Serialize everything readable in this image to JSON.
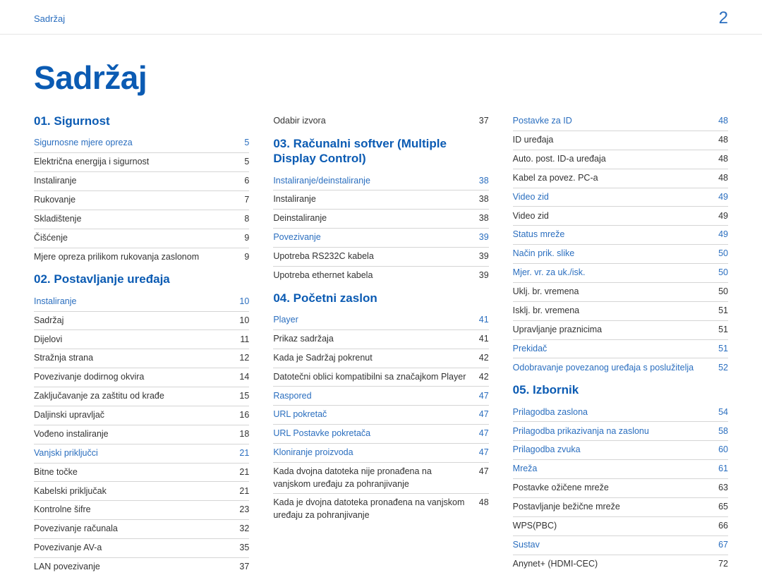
{
  "header": {
    "breadcrumb": "Sadržaj",
    "pageNumber": "2"
  },
  "title": "Sadržaj",
  "columns": [
    [
      {
        "type": "heading",
        "text": "01. Sigurnost",
        "first": true
      },
      {
        "type": "entry",
        "level": 1,
        "label": "Sigurnosne mjere opreza",
        "page": "5"
      },
      {
        "type": "sep"
      },
      {
        "type": "entry",
        "level": 2,
        "label": "Električna energija i sigurnost",
        "page": "5"
      },
      {
        "type": "sep"
      },
      {
        "type": "entry",
        "level": 2,
        "label": "Instaliranje",
        "page": "6"
      },
      {
        "type": "sep"
      },
      {
        "type": "entry",
        "level": 2,
        "label": "Rukovanje",
        "page": "7"
      },
      {
        "type": "sep"
      },
      {
        "type": "entry",
        "level": 2,
        "label": "Skladištenje",
        "page": "8"
      },
      {
        "type": "sep"
      },
      {
        "type": "entry",
        "level": 2,
        "label": "Čišćenje",
        "page": "9"
      },
      {
        "type": "sep"
      },
      {
        "type": "entry",
        "level": 2,
        "label": "Mjere opreza prilikom rukovanja zaslonom",
        "page": "9"
      },
      {
        "type": "heading",
        "text": "02. Postavljanje uređaja"
      },
      {
        "type": "entry",
        "level": 1,
        "label": "Instaliranje",
        "page": "10"
      },
      {
        "type": "sep"
      },
      {
        "type": "entry",
        "level": 2,
        "label": "Sadržaj",
        "page": "10"
      },
      {
        "type": "sep"
      },
      {
        "type": "entry",
        "level": 2,
        "label": "Dijelovi",
        "page": "11"
      },
      {
        "type": "sep"
      },
      {
        "type": "entry",
        "level": 2,
        "label": "Stražnja strana",
        "page": "12"
      },
      {
        "type": "sep"
      },
      {
        "type": "entry",
        "level": 2,
        "label": "Povezivanje dodirnog okvira",
        "page": "14"
      },
      {
        "type": "sep"
      },
      {
        "type": "entry",
        "level": 2,
        "label": "Zaključavanje za zaštitu od krađe",
        "page": "15"
      },
      {
        "type": "sep"
      },
      {
        "type": "entry",
        "level": 2,
        "label": "Daljinski upravljač",
        "page": "16"
      },
      {
        "type": "sep"
      },
      {
        "type": "entry",
        "level": 2,
        "label": "Vođeno instaliranje",
        "page": "18"
      },
      {
        "type": "sep"
      },
      {
        "type": "entry",
        "level": 1,
        "label": "Vanjski priključci",
        "page": "21"
      },
      {
        "type": "sep"
      },
      {
        "type": "entry",
        "level": 2,
        "label": "Bitne točke",
        "page": "21"
      },
      {
        "type": "sep"
      },
      {
        "type": "entry",
        "level": 2,
        "label": "Kabelski priključak",
        "page": "21"
      },
      {
        "type": "sep"
      },
      {
        "type": "entry",
        "level": 2,
        "label": "Kontrolne šifre",
        "page": "23"
      },
      {
        "type": "sep"
      },
      {
        "type": "entry",
        "level": 2,
        "label": "Povezivanje računala",
        "page": "32"
      },
      {
        "type": "sep"
      },
      {
        "type": "entry",
        "level": 2,
        "label": "Povezivanje AV-a",
        "page": "35"
      },
      {
        "type": "sep"
      },
      {
        "type": "entry",
        "level": 2,
        "label": "LAN povezivanje",
        "page": "37"
      }
    ],
    [
      {
        "type": "entry",
        "level": 2,
        "label": "Odabir izvora",
        "page": "37",
        "first": true
      },
      {
        "type": "heading",
        "text": "03. Računalni softver (Multiple Display Control)"
      },
      {
        "type": "entry",
        "level": 1,
        "label": "Instaliranje/deinstaliranje",
        "page": "38"
      },
      {
        "type": "sep"
      },
      {
        "type": "entry",
        "level": 2,
        "label": "Instaliranje",
        "page": "38"
      },
      {
        "type": "sep"
      },
      {
        "type": "entry",
        "level": 2,
        "label": "Deinstaliranje",
        "page": "38"
      },
      {
        "type": "sep"
      },
      {
        "type": "entry",
        "level": 1,
        "label": "Povezivanje",
        "page": "39"
      },
      {
        "type": "sep"
      },
      {
        "type": "entry",
        "level": 2,
        "label": "Upotreba RS232C kabela",
        "page": "39"
      },
      {
        "type": "sep"
      },
      {
        "type": "entry",
        "level": 2,
        "label": "Upotreba ethernet kabela",
        "page": "39"
      },
      {
        "type": "heading",
        "text": "04. Početni zaslon"
      },
      {
        "type": "entry",
        "level": 1,
        "label": "Player",
        "page": "41"
      },
      {
        "type": "sep"
      },
      {
        "type": "entry",
        "level": 2,
        "label": "Prikaz sadržaja",
        "page": "41"
      },
      {
        "type": "sep"
      },
      {
        "type": "entry",
        "level": 2,
        "label": "Kada je Sadržaj pokrenut",
        "page": "42"
      },
      {
        "type": "sep"
      },
      {
        "type": "entry",
        "level": 2,
        "label": "Datotečni oblici kompatibilni sa značajkom Player",
        "page": "42"
      },
      {
        "type": "sep"
      },
      {
        "type": "entry",
        "level": 1,
        "label": "Raspored",
        "page": "47"
      },
      {
        "type": "sep"
      },
      {
        "type": "entry",
        "level": 1,
        "label": "URL pokretač",
        "page": "47"
      },
      {
        "type": "sep"
      },
      {
        "type": "entry",
        "level": 1,
        "label": "URL Postavke pokretača",
        "page": "47"
      },
      {
        "type": "sep"
      },
      {
        "type": "entry",
        "level": 1,
        "label": "Kloniranje proizvoda",
        "page": "47"
      },
      {
        "type": "sep"
      },
      {
        "type": "entry",
        "level": 2,
        "label": "Kada dvojna datoteka nije pronađena na vanjskom uređaju za pohranjivanje",
        "page": "47"
      },
      {
        "type": "sep"
      },
      {
        "type": "entry",
        "level": 2,
        "label": "Kada je dvojna datoteka pronađena na vanjskom uređaju za pohranjivanje",
        "page": "48"
      }
    ],
    [
      {
        "type": "entry",
        "level": 1,
        "label": "Postavke za ID",
        "page": "48",
        "first": true
      },
      {
        "type": "sep"
      },
      {
        "type": "entry",
        "level": 2,
        "label": "ID uređaja",
        "page": "48"
      },
      {
        "type": "sep"
      },
      {
        "type": "entry",
        "level": 2,
        "label": "Auto. post. ID-a uređaja",
        "page": "48"
      },
      {
        "type": "sep"
      },
      {
        "type": "entry",
        "level": 2,
        "label": "Kabel za povez. PC-a",
        "page": "48"
      },
      {
        "type": "sep"
      },
      {
        "type": "entry",
        "level": 1,
        "label": "Video zid",
        "page": "49"
      },
      {
        "type": "sep"
      },
      {
        "type": "entry",
        "level": 2,
        "label": "Video zid",
        "page": "49"
      },
      {
        "type": "sep"
      },
      {
        "type": "entry",
        "level": 1,
        "label": "Status mreže",
        "page": "49"
      },
      {
        "type": "sep"
      },
      {
        "type": "entry",
        "level": 1,
        "label": "Način prik. slike",
        "page": "50"
      },
      {
        "type": "sep"
      },
      {
        "type": "entry",
        "level": 1,
        "label": "Mjer. vr. za uk./isk.",
        "page": "50"
      },
      {
        "type": "sep"
      },
      {
        "type": "entry",
        "level": 2,
        "label": "Uklj. br. vremena",
        "page": "50"
      },
      {
        "type": "sep"
      },
      {
        "type": "entry",
        "level": 2,
        "label": "Isklj. br. vremena",
        "page": "51"
      },
      {
        "type": "sep"
      },
      {
        "type": "entry",
        "level": 2,
        "label": "Upravljanje praznicima",
        "page": "51"
      },
      {
        "type": "sep"
      },
      {
        "type": "entry",
        "level": 1,
        "label": "Prekidač",
        "page": "51"
      },
      {
        "type": "sep"
      },
      {
        "type": "entry",
        "level": 1,
        "label": "Odobravanje povezanog uređaja s poslužitelja",
        "page": "52"
      },
      {
        "type": "heading",
        "text": "05. Izbornik"
      },
      {
        "type": "entry",
        "level": 1,
        "label": "Prilagodba zaslona",
        "page": "54"
      },
      {
        "type": "sep"
      },
      {
        "type": "entry",
        "level": 1,
        "label": "Prilagodba prikazivanja na zaslonu",
        "page": "58"
      },
      {
        "type": "sep"
      },
      {
        "type": "entry",
        "level": 1,
        "label": "Prilagodba zvuka",
        "page": "60"
      },
      {
        "type": "sep"
      },
      {
        "type": "entry",
        "level": 1,
        "label": "Mreža",
        "page": "61"
      },
      {
        "type": "sep"
      },
      {
        "type": "entry",
        "level": 2,
        "label": "Postavke ožičene mreže",
        "page": "63"
      },
      {
        "type": "sep"
      },
      {
        "type": "entry",
        "level": 2,
        "label": "Postavljanje bežične mreže",
        "page": "65"
      },
      {
        "type": "sep"
      },
      {
        "type": "entry",
        "level": 2,
        "label": "WPS(PBC)",
        "page": "66"
      },
      {
        "type": "sep"
      },
      {
        "type": "entry",
        "level": 1,
        "label": "Sustav",
        "page": "67"
      },
      {
        "type": "sep"
      },
      {
        "type": "entry",
        "level": 2,
        "label": "Anynet+ (HDMI-CEC)",
        "page": "72"
      }
    ]
  ]
}
